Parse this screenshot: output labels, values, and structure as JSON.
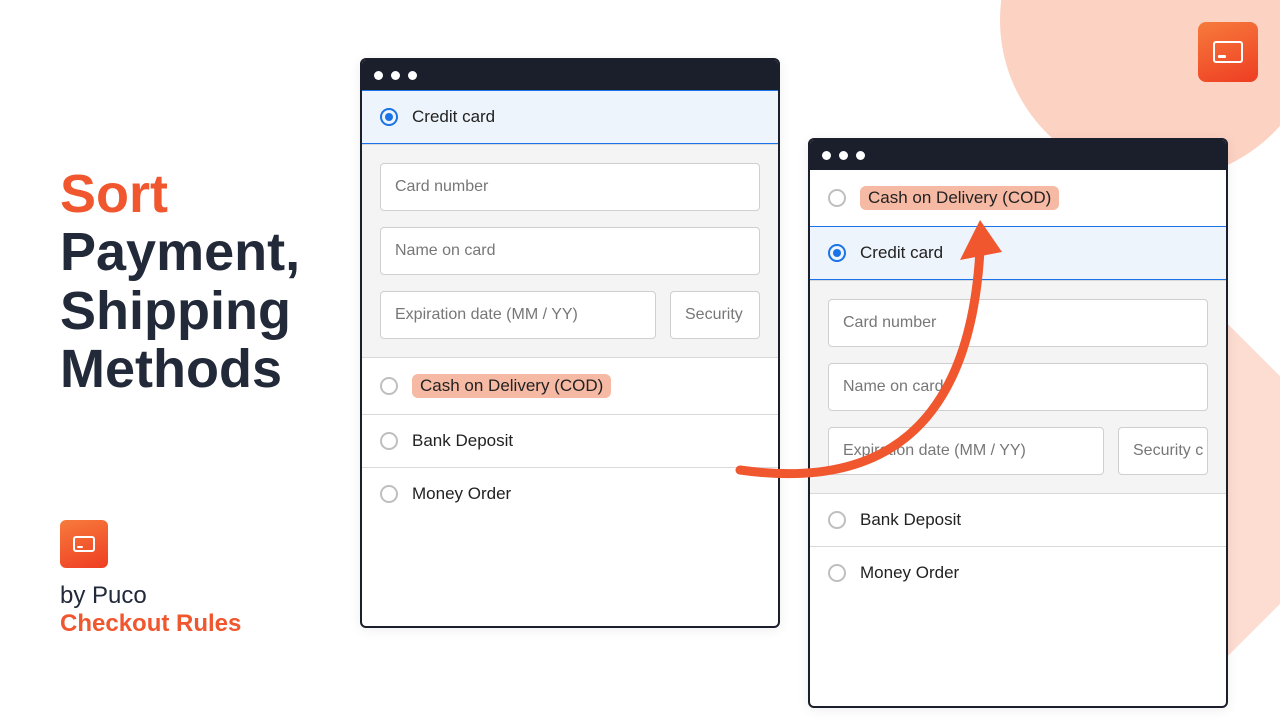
{
  "copy": {
    "accent": "Sort",
    "line2": "Payment,",
    "line3": "Shipping",
    "line4": "Methods"
  },
  "brand": {
    "by": "by Puco",
    "app": "Checkout Rules"
  },
  "windowA": {
    "options": [
      {
        "label": "Credit card",
        "selected": true
      },
      {
        "label": "Cash on Delivery (COD)",
        "highlighted": true
      },
      {
        "label": "Bank Deposit"
      },
      {
        "label": "Money Order"
      }
    ],
    "fields": {
      "card_number": "Card number",
      "name_on_card": "Name on card",
      "expiry": "Expiration date (MM / YY)",
      "cvv": "Security"
    }
  },
  "windowB": {
    "options": [
      {
        "label": "Cash on Delivery (COD)",
        "highlighted": true
      },
      {
        "label": "Credit card",
        "selected": true
      },
      {
        "label": "Bank Deposit"
      },
      {
        "label": "Money Order"
      }
    ],
    "fields": {
      "card_number": "Card number",
      "name_on_card": "Name on card",
      "expiry": "Expiration date (MM / YY)",
      "cvv": "Security c"
    }
  }
}
